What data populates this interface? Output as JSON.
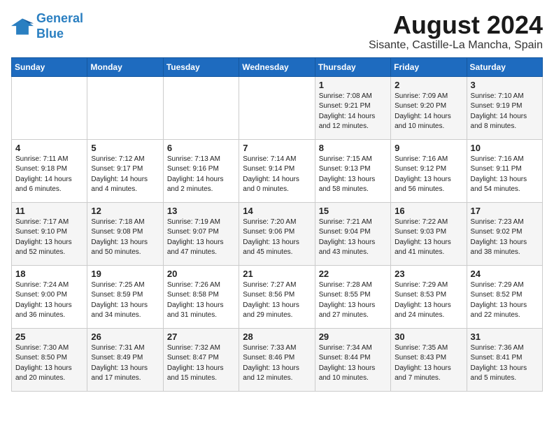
{
  "logo": {
    "line1": "General",
    "line2": "Blue"
  },
  "title": "August 2024",
  "location": "Sisante, Castille-La Mancha, Spain",
  "weekdays": [
    "Sunday",
    "Monday",
    "Tuesday",
    "Wednesday",
    "Thursday",
    "Friday",
    "Saturday"
  ],
  "weeks": [
    [
      {
        "day": "",
        "info": ""
      },
      {
        "day": "",
        "info": ""
      },
      {
        "day": "",
        "info": ""
      },
      {
        "day": "",
        "info": ""
      },
      {
        "day": "1",
        "info": "Sunrise: 7:08 AM\nSunset: 9:21 PM\nDaylight: 14 hours\nand 12 minutes."
      },
      {
        "day": "2",
        "info": "Sunrise: 7:09 AM\nSunset: 9:20 PM\nDaylight: 14 hours\nand 10 minutes."
      },
      {
        "day": "3",
        "info": "Sunrise: 7:10 AM\nSunset: 9:19 PM\nDaylight: 14 hours\nand 8 minutes."
      }
    ],
    [
      {
        "day": "4",
        "info": "Sunrise: 7:11 AM\nSunset: 9:18 PM\nDaylight: 14 hours\nand 6 minutes."
      },
      {
        "day": "5",
        "info": "Sunrise: 7:12 AM\nSunset: 9:17 PM\nDaylight: 14 hours\nand 4 minutes."
      },
      {
        "day": "6",
        "info": "Sunrise: 7:13 AM\nSunset: 9:16 PM\nDaylight: 14 hours\nand 2 minutes."
      },
      {
        "day": "7",
        "info": "Sunrise: 7:14 AM\nSunset: 9:14 PM\nDaylight: 14 hours\nand 0 minutes."
      },
      {
        "day": "8",
        "info": "Sunrise: 7:15 AM\nSunset: 9:13 PM\nDaylight: 13 hours\nand 58 minutes."
      },
      {
        "day": "9",
        "info": "Sunrise: 7:16 AM\nSunset: 9:12 PM\nDaylight: 13 hours\nand 56 minutes."
      },
      {
        "day": "10",
        "info": "Sunrise: 7:16 AM\nSunset: 9:11 PM\nDaylight: 13 hours\nand 54 minutes."
      }
    ],
    [
      {
        "day": "11",
        "info": "Sunrise: 7:17 AM\nSunset: 9:10 PM\nDaylight: 13 hours\nand 52 minutes."
      },
      {
        "day": "12",
        "info": "Sunrise: 7:18 AM\nSunset: 9:08 PM\nDaylight: 13 hours\nand 50 minutes."
      },
      {
        "day": "13",
        "info": "Sunrise: 7:19 AM\nSunset: 9:07 PM\nDaylight: 13 hours\nand 47 minutes."
      },
      {
        "day": "14",
        "info": "Sunrise: 7:20 AM\nSunset: 9:06 PM\nDaylight: 13 hours\nand 45 minutes."
      },
      {
        "day": "15",
        "info": "Sunrise: 7:21 AM\nSunset: 9:04 PM\nDaylight: 13 hours\nand 43 minutes."
      },
      {
        "day": "16",
        "info": "Sunrise: 7:22 AM\nSunset: 9:03 PM\nDaylight: 13 hours\nand 41 minutes."
      },
      {
        "day": "17",
        "info": "Sunrise: 7:23 AM\nSunset: 9:02 PM\nDaylight: 13 hours\nand 38 minutes."
      }
    ],
    [
      {
        "day": "18",
        "info": "Sunrise: 7:24 AM\nSunset: 9:00 PM\nDaylight: 13 hours\nand 36 minutes."
      },
      {
        "day": "19",
        "info": "Sunrise: 7:25 AM\nSunset: 8:59 PM\nDaylight: 13 hours\nand 34 minutes."
      },
      {
        "day": "20",
        "info": "Sunrise: 7:26 AM\nSunset: 8:58 PM\nDaylight: 13 hours\nand 31 minutes."
      },
      {
        "day": "21",
        "info": "Sunrise: 7:27 AM\nSunset: 8:56 PM\nDaylight: 13 hours\nand 29 minutes."
      },
      {
        "day": "22",
        "info": "Sunrise: 7:28 AM\nSunset: 8:55 PM\nDaylight: 13 hours\nand 27 minutes."
      },
      {
        "day": "23",
        "info": "Sunrise: 7:29 AM\nSunset: 8:53 PM\nDaylight: 13 hours\nand 24 minutes."
      },
      {
        "day": "24",
        "info": "Sunrise: 7:29 AM\nSunset: 8:52 PM\nDaylight: 13 hours\nand 22 minutes."
      }
    ],
    [
      {
        "day": "25",
        "info": "Sunrise: 7:30 AM\nSunset: 8:50 PM\nDaylight: 13 hours\nand 20 minutes."
      },
      {
        "day": "26",
        "info": "Sunrise: 7:31 AM\nSunset: 8:49 PM\nDaylight: 13 hours\nand 17 minutes."
      },
      {
        "day": "27",
        "info": "Sunrise: 7:32 AM\nSunset: 8:47 PM\nDaylight: 13 hours\nand 15 minutes."
      },
      {
        "day": "28",
        "info": "Sunrise: 7:33 AM\nSunset: 8:46 PM\nDaylight: 13 hours\nand 12 minutes."
      },
      {
        "day": "29",
        "info": "Sunrise: 7:34 AM\nSunset: 8:44 PM\nDaylight: 13 hours\nand 10 minutes."
      },
      {
        "day": "30",
        "info": "Sunrise: 7:35 AM\nSunset: 8:43 PM\nDaylight: 13 hours\nand 7 minutes."
      },
      {
        "day": "31",
        "info": "Sunrise: 7:36 AM\nSunset: 8:41 PM\nDaylight: 13 hours\nand 5 minutes."
      }
    ]
  ]
}
